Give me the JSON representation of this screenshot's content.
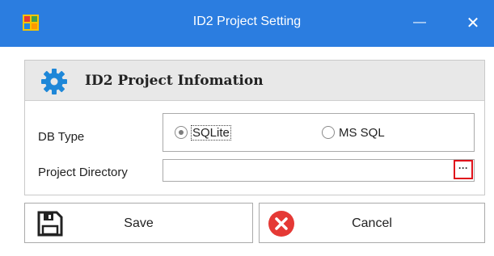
{
  "window": {
    "title": "ID2 Project Setting",
    "minimize_glyph": "—",
    "close_glyph": "✕",
    "titlebar_color": "#2b7de0"
  },
  "panel": {
    "title": "ID2 Project Infomation",
    "icon": "gear-icon",
    "icon_color": "#1e87d8"
  },
  "form": {
    "db_type_label": "DB Type",
    "db_options": [
      "SQLite",
      "MS SQL"
    ],
    "db_selected": "SQLite",
    "project_dir_label": "Project Directory",
    "project_dir_value": "",
    "browse_label": "···",
    "browse_highlight_color": "#e0121b"
  },
  "buttons": {
    "save_label": "Save",
    "save_icon": "floppy-disk-icon",
    "cancel_label": "Cancel",
    "cancel_icon": "cancel-circle-icon",
    "cancel_color": "#e53935"
  }
}
